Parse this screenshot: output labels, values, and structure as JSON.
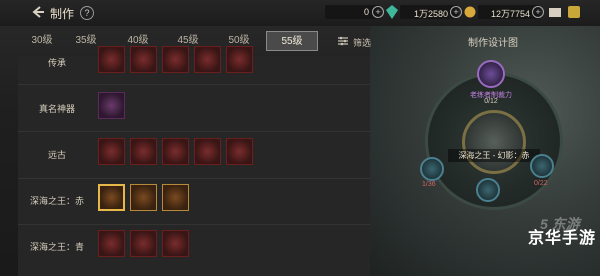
{
  "header": {
    "title": "制作",
    "help_label": "?",
    "currencies": [
      {
        "value": "0"
      },
      {
        "value": "1万2580"
      },
      {
        "value": "12万7754"
      }
    ]
  },
  "tabs": [
    {
      "label": "30级"
    },
    {
      "label": "35级"
    },
    {
      "label": "40级"
    },
    {
      "label": "45级"
    },
    {
      "label": "50级"
    },
    {
      "label": "55级",
      "active": true
    }
  ],
  "filter_label": "筛选",
  "rows": [
    {
      "label": "传承"
    },
    {
      "label": "真名神器"
    },
    {
      "label": "远古"
    },
    {
      "label": "深海之王：赤"
    },
    {
      "label": "深海之王：青"
    }
  ],
  "diagram": {
    "title": "制作设计图",
    "top_node_name": "老练者制裁力",
    "top_node_count": "0/12",
    "center_label": "深海之王 - 幻影：赤",
    "left_count": "1/36",
    "right_count": "0/22"
  },
  "watermark": {
    "text": "京华手游",
    "logo_text": "5 东游"
  }
}
